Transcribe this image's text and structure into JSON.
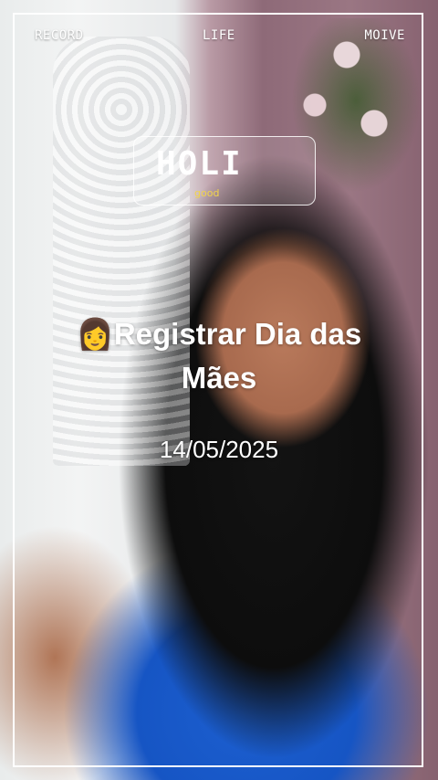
{
  "top_bar": {
    "left_label": "RECORD",
    "center_label": "LIFE",
    "right_label": "MOIVE"
  },
  "overlay_card": {
    "title": "HOLI",
    "subtitle": "good"
  },
  "caption": {
    "emoji": "👩",
    "headline": "Registrar Dia das Mães",
    "date": "14/05/2025"
  },
  "colors": {
    "frame": "#ffffff",
    "text": "#ffffff",
    "subtitle_accent": "#f2d44a",
    "top_blue": "#1655c4"
  }
}
